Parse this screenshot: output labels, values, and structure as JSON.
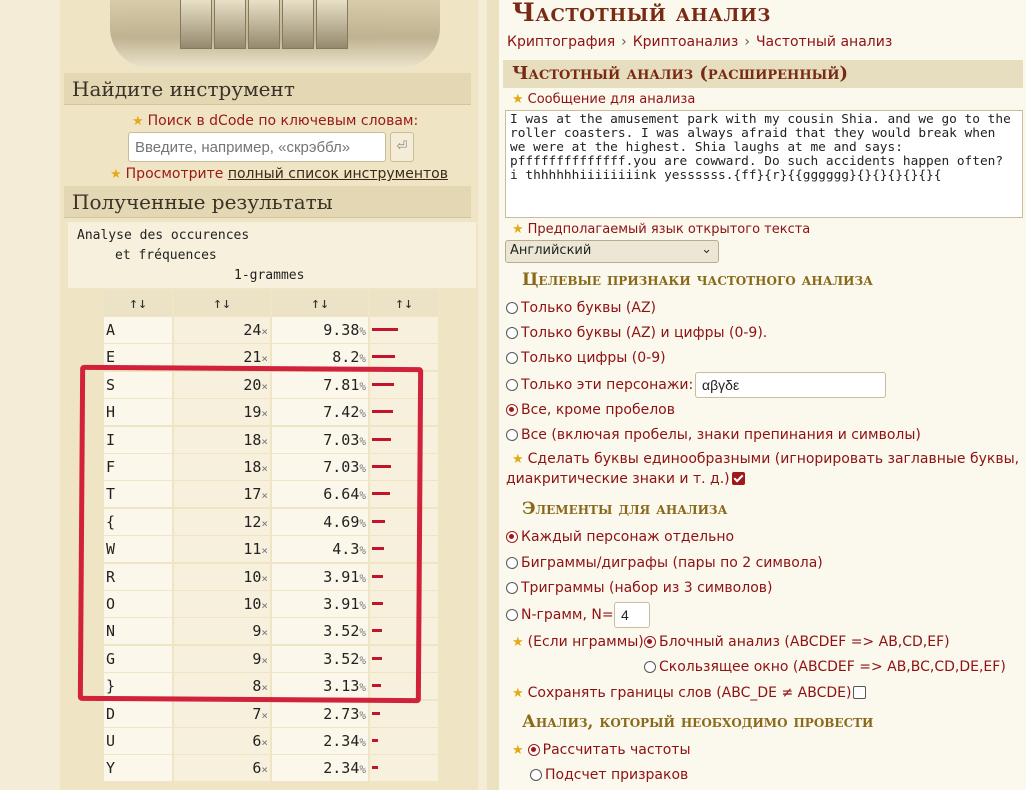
{
  "sidebar": {
    "find_tool_heading": "Найдите инструмент",
    "search_label": "Поиск в dCode по ключевым словам:",
    "search_placeholder": "Введите, например, «скрэббл»",
    "search_button": "⏎",
    "list_prefix": "Просмотрите",
    "list_link": "полный список инструментов",
    "results_heading": "Полученные результаты"
  },
  "results": {
    "header_line1": "Analyse des occurences",
    "header_line2": "et fréquences",
    "header_line3": "1-grammes",
    "sort_labels": [
      "↑↓",
      "↑↓",
      "↑↓",
      "↑↓"
    ],
    "count_suffix": "×",
    "pct_suffix": "%",
    "rows": [
      {
        "letter": "A",
        "count": "24",
        "pct": "9.38",
        "share": 9.38
      },
      {
        "letter": "E",
        "count": "21",
        "pct": "8.2",
        "share": 8.2
      },
      {
        "letter": "S",
        "count": "20",
        "pct": "7.81",
        "share": 7.81
      },
      {
        "letter": "H",
        "count": "19",
        "pct": "7.42",
        "share": 7.42
      },
      {
        "letter": "I",
        "count": "18",
        "pct": "7.03",
        "share": 7.03
      },
      {
        "letter": "F",
        "count": "18",
        "pct": "7.03",
        "share": 7.03
      },
      {
        "letter": "T",
        "count": "17",
        "pct": "6.64",
        "share": 6.64
      },
      {
        "letter": "{",
        "count": "12",
        "pct": "4.69",
        "share": 4.69
      },
      {
        "letter": "W",
        "count": "11",
        "pct": "4.3",
        "share": 4.3
      },
      {
        "letter": "R",
        "count": "10",
        "pct": "3.91",
        "share": 3.91
      },
      {
        "letter": "O",
        "count": "10",
        "pct": "3.91",
        "share": 3.91
      },
      {
        "letter": "N",
        "count": "9",
        "pct": "3.52",
        "share": 3.52
      },
      {
        "letter": "G",
        "count": "9",
        "pct": "3.52",
        "share": 3.52
      },
      {
        "letter": "}",
        "count": "8",
        "pct": "3.13",
        "share": 3.13
      },
      {
        "letter": "D",
        "count": "7",
        "pct": "2.73",
        "share": 2.73
      },
      {
        "letter": "U",
        "count": "6",
        "pct": "2.34",
        "share": 2.34
      },
      {
        "letter": "Y",
        "count": "6",
        "pct": "2.34",
        "share": 2.34
      }
    ]
  },
  "page": {
    "title": "Частотный анализ",
    "breadcrumb": [
      "Криптография",
      "Криптоанализ",
      "Частотный анализ"
    ],
    "tool_heading": "Частотный анализ (расширенный)"
  },
  "form": {
    "message_label": "Сообщение для анализа",
    "message_value": "I was at the amusement park with my cousin Shia. and we go to the roller coasters. I was always afraid that they would break when we were at the highest. Shia laughs at me and says: pffffffffffffff.you are cowward. Do such accidents happen often? i thhhhhhiiiiiiiink yessssss.{ff}{r}{{gggggg}{}{}{}{}{}{",
    "language_label": "Предполагаемый язык открытого текста",
    "language_value": "Английский",
    "targets_heading": "Целевые признаки частотного анализа",
    "targets": [
      "Только буквы (AZ)",
      "Только буквы (AZ) и цифры (0-9).",
      "Только цифры (0-9)",
      "Только эти персонажи:",
      "Все, кроме пробелов",
      "Все (включая пробелы, знаки препинания и символы)"
    ],
    "targets_selected": 4,
    "custom_chars_value": "αβγδε",
    "uniform_label_1": "Сделать буквы единообразными (игнорировать заглавные буквы,",
    "uniform_label_2": "диакритические знаки и т. д.)",
    "uniform_checked": true,
    "elements_heading": "Элементы для анализа",
    "elements": [
      "Каждый персонаж отдельно",
      "Биграммы/диграфы (пары по 2 символа)",
      "Триграммы (набор из 3 символов)",
      "N-грамм, N="
    ],
    "elements_selected": 0,
    "ngram_value": "4",
    "if_ngram_label": "(Если нграммы)",
    "block_label": "Блочный анализ (ABCDEF => AB,CD,EF)",
    "sliding_label": "Скользящее окно (ABCDEF => AB,BC,CD,DE,EF)",
    "keep_bounds_label": "Сохранять границы слов (ABC_DE ≠ ABCDE)",
    "keep_bounds_checked": false,
    "analysis_heading": "Анализ, который необходимо провести",
    "analysis_opt1": "Рассчитать частоты",
    "analysis_opt2": "Подсчет призраков"
  }
}
